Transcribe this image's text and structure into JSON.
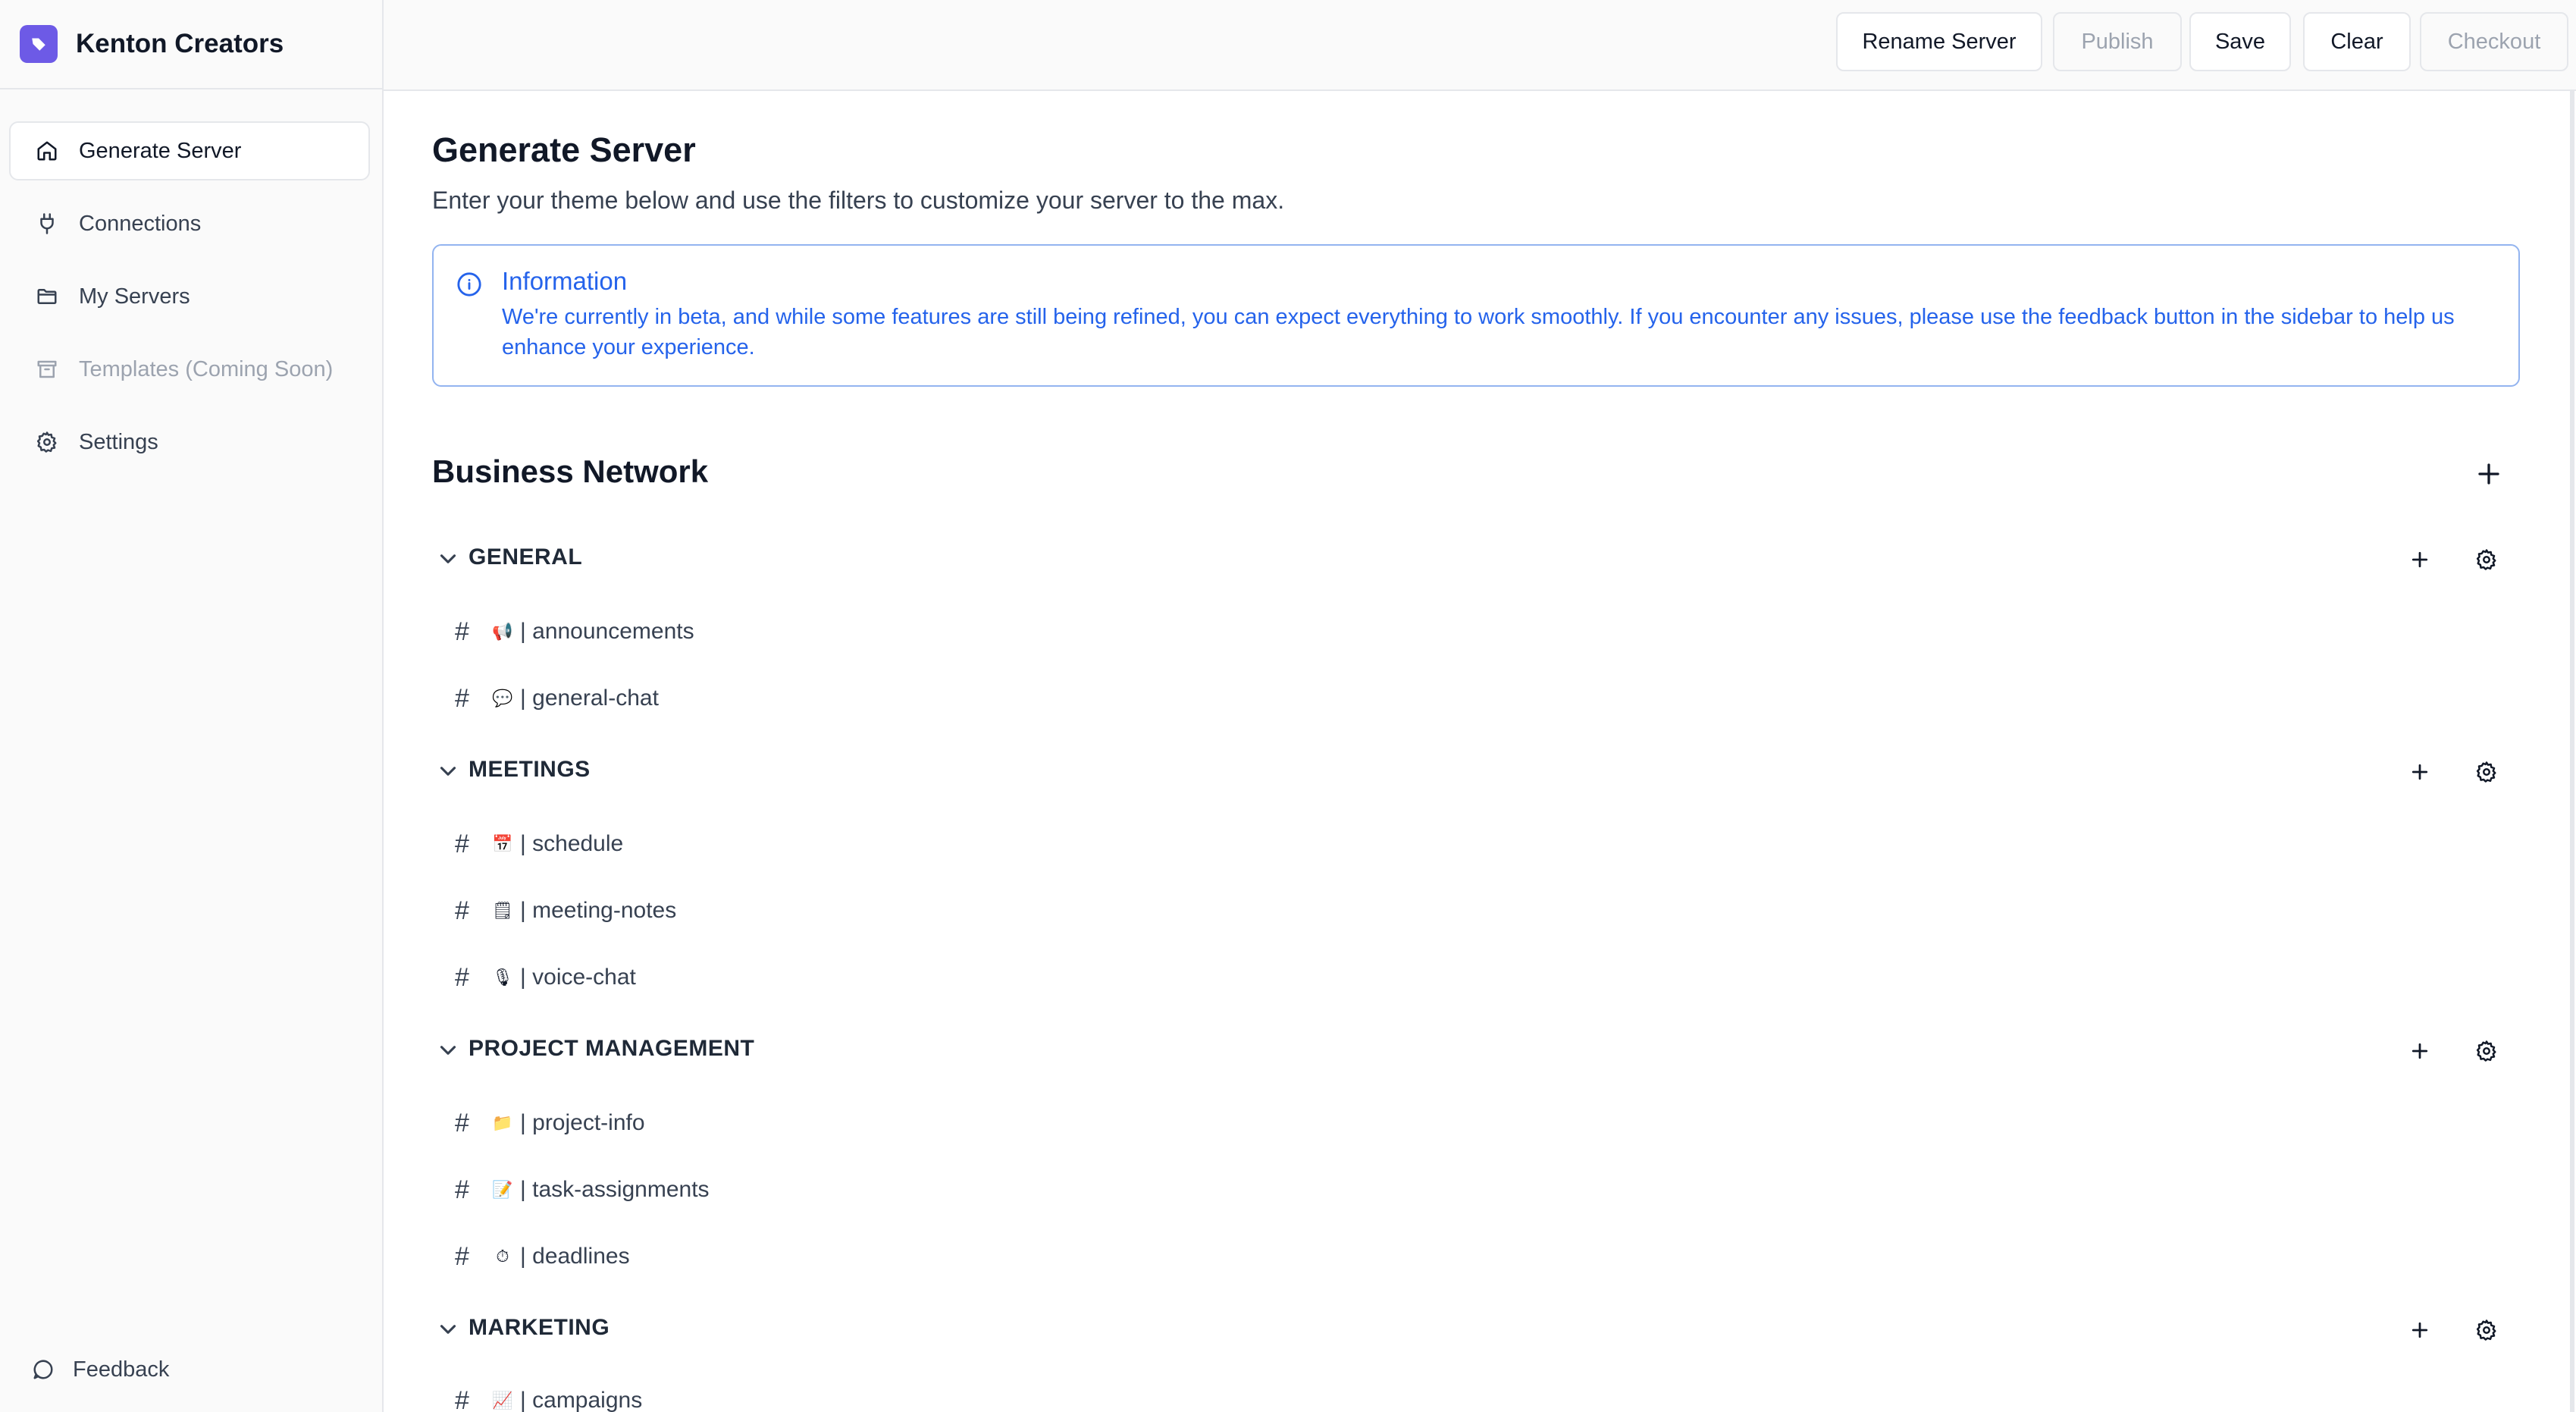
{
  "brand": {
    "name": "Kenton Creators",
    "accent": "#6d5ae6"
  },
  "sidebar": {
    "items": [
      {
        "label": "Generate Server",
        "icon": "home-icon",
        "active": true
      },
      {
        "label": "Connections",
        "icon": "plug-icon"
      },
      {
        "label": "My Servers",
        "icon": "folder-icon"
      },
      {
        "label": "Templates (Coming Soon)",
        "icon": "archive-icon",
        "disabled": true
      },
      {
        "label": "Settings",
        "icon": "gear-icon"
      }
    ],
    "feedback_label": "Feedback"
  },
  "toolbar": {
    "rename": "Rename Server",
    "publish": "Publish",
    "save": "Save",
    "clear": "Clear",
    "checkout": "Checkout"
  },
  "main": {
    "title": "Generate Server",
    "subtitle": "Enter your theme below and use the filters to customize your server to the max.",
    "info": {
      "title": "Information",
      "text": "We're currently in beta, and while some features are still being refined, you can expect everything to work smoothly. If you encounter any issues, please use the feedback button in the sidebar to help us enhance your experience."
    },
    "server_name": "Business Network",
    "categories": [
      {
        "name": "GENERAL",
        "channels": [
          {
            "emoji": "📢",
            "name": "| announcements"
          },
          {
            "emoji": "💬",
            "name": "| general-chat"
          }
        ]
      },
      {
        "name": "MEETINGS",
        "channels": [
          {
            "emoji": "📅",
            "name": "| schedule"
          },
          {
            "emoji": "🗒",
            "name": "| meeting-notes"
          },
          {
            "emoji": "🎙",
            "name": "| voice-chat"
          }
        ]
      },
      {
        "name": "PROJECT MANAGEMENT",
        "channels": [
          {
            "emoji": "📁",
            "name": "| project-info"
          },
          {
            "emoji": "📝",
            "name": "| task-assignments"
          },
          {
            "emoji": "⏱",
            "name": "| deadlines"
          }
        ]
      },
      {
        "name": "MARKETING",
        "channels": [
          {
            "emoji": "📈",
            "name": "| campaigns"
          }
        ]
      }
    ]
  }
}
